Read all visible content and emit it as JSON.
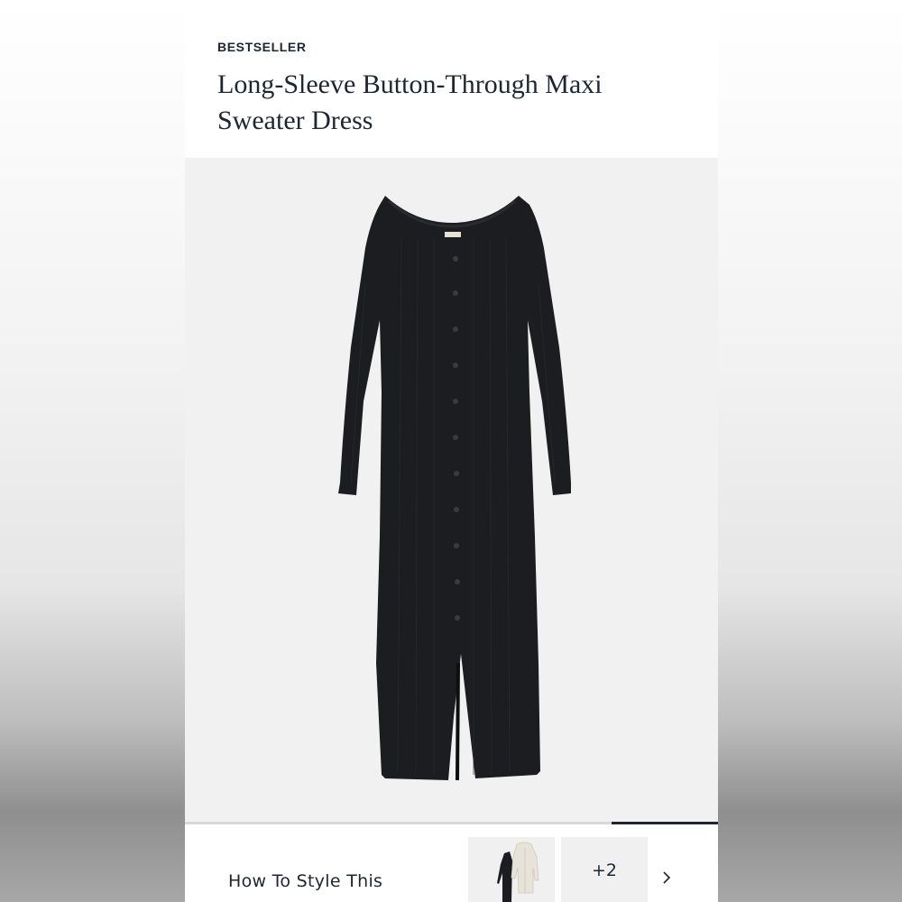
{
  "product": {
    "badge": "BESTSELLER",
    "title": "Long-Sleeve Button-Through Maxi Sweater Dress",
    "image": {
      "subject": "black ribbed maxi sweater dress",
      "color": "#1c1d20"
    }
  },
  "carousel": {
    "progress": 0.2
  },
  "style_section": {
    "label": "How To Style This",
    "more_count": "+2",
    "next_icon": "chevron-right-icon"
  },
  "colors": {
    "text": "#1d2733",
    "image_bg": "#f1f1f1",
    "thumb_bg": "#f0f0f0"
  }
}
